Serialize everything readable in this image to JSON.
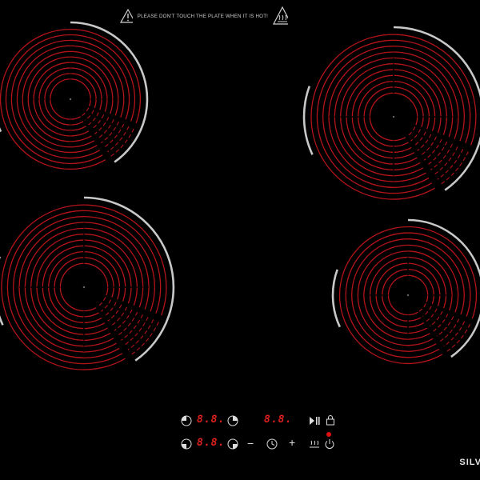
{
  "warning": {
    "text": "PLEASE DON'T TOUCH THE PLATE  WHEN IT IS HOT!"
  },
  "brand": {
    "text": "SILV"
  },
  "displays": {
    "top_left": "8.8.",
    "top_mid": "8.8.",
    "bottom_left": "8.8."
  },
  "controls": {
    "minus": "−",
    "plus": "+"
  },
  "icons": {
    "warning_triangle": "warning-triangle-icon",
    "hot_surface": "hot-surface-icon",
    "zone_select": "zone-select-icon",
    "play_pause": "play-pause-icon",
    "lock": "lock-icon",
    "timer": "timer-icon",
    "keep_warm": "keep-warm-icon",
    "power": "power-icon"
  },
  "colors": {
    "coil": "#b3141a",
    "rim": "#c8c8c8",
    "display": "#e02020"
  }
}
